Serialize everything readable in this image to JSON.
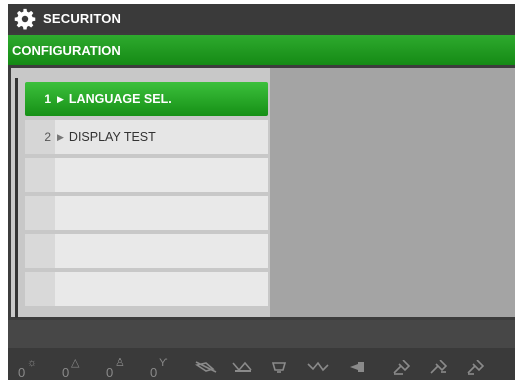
{
  "app": {
    "title": "SECURITON",
    "icon": "gear-icon"
  },
  "menu": {
    "title": "CONFIGURATION",
    "items": [
      {
        "number": "1",
        "label": "LANGUAGE SEL.",
        "selected": true
      },
      {
        "number": "2",
        "label": "DISPLAY TEST",
        "selected": false
      },
      {
        "number": "",
        "label": "",
        "selected": false
      },
      {
        "number": "",
        "label": "",
        "selected": false
      },
      {
        "number": "",
        "label": "",
        "selected": false
      },
      {
        "number": "",
        "label": "",
        "selected": false
      }
    ]
  },
  "status": {
    "counters": [
      {
        "value": "0",
        "icon": "sun-icon"
      },
      {
        "value": "0",
        "icon": "warning-triangle-icon"
      },
      {
        "value": "0",
        "icon": "person-icon"
      },
      {
        "value": "0",
        "icon": "tool-icon"
      }
    ],
    "icons": [
      "horn-off-icon",
      "siren-off-icon",
      "bell-icon",
      "signal-icon",
      "speaker-icon",
      "key-icon",
      "key-double-icon",
      "key-alt-icon"
    ]
  },
  "colors": {
    "accent": "#1e9a1e",
    "title_bg": "#3a3a3a",
    "panel": "#a4a4a4"
  }
}
